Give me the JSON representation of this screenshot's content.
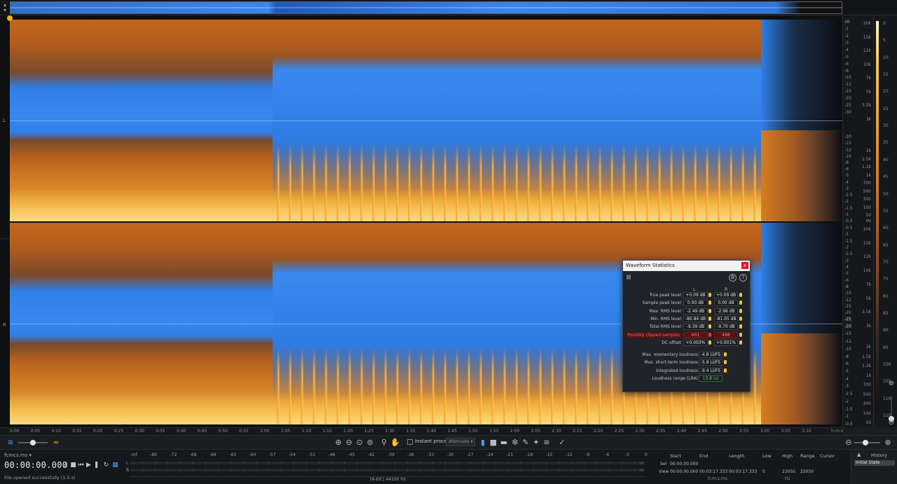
{
  "overview": {
    "collapse_icon": "collapse-icon"
  },
  "channels": {
    "left_label": "L",
    "right_label": "R"
  },
  "time_ruler": {
    "ticks": [
      "0:00",
      "0:05",
      "0:10",
      "0:15",
      "0:20",
      "0:25",
      "0:30",
      "0:35",
      "0:40",
      "0:45",
      "0:50",
      "0:55",
      "1:00",
      "1:05",
      "1:10",
      "1:15",
      "1:20",
      "1:25",
      "1:30",
      "1:35",
      "1:40",
      "1:45",
      "1:50",
      "1:55",
      "2:00",
      "2:05",
      "2:10",
      "2:15",
      "2:20",
      "2:25",
      "2:30",
      "2:35",
      "2:40",
      "2:45",
      "2:50",
      "2:55",
      "3:00",
      "3:05",
      "3:10"
    ],
    "unit": "h:m:s"
  },
  "freq_scale": {
    "db_left_top": [
      "dB",
      "-1",
      "-2",
      "-3",
      "-4",
      "-5",
      "-6",
      "-8",
      "-10",
      "-12",
      "-15",
      "-20",
      "-25",
      "-30"
    ],
    "db_left_bottom": [
      "-20",
      "-15",
      "-12",
      "-10",
      "-8",
      "-6",
      "-5",
      "-4",
      "-3",
      "-2.5",
      "-2",
      "-1.5",
      "-1",
      "-0.5"
    ],
    "hz_top": [
      "20k",
      "15k",
      "12k",
      "10k",
      "7k",
      "5k",
      "3.5k",
      "3k"
    ],
    "hz_bottom": [
      "2k",
      "1.5k",
      "1.2k",
      "1k",
      "700",
      "500",
      "300",
      "100",
      "50"
    ],
    "hz_unit": "Hz",
    "db_right_top": [
      "-0.5",
      "-1",
      "-1.5",
      "-2",
      "-2.5",
      "-3",
      "-4",
      "-5",
      "-6",
      "-8",
      "-10",
      "-12",
      "-15",
      "-20",
      "-25",
      "-30"
    ],
    "db_right_bottom": [
      "-25",
      "-20",
      "-15",
      "-12",
      "-10",
      "-8",
      "-6",
      "-5",
      "-4",
      "-3",
      "-2.5",
      "-2",
      "-1.5",
      "-1",
      "-0.5"
    ],
    "hz_r_top": [
      "20k",
      "15k",
      "12k",
      "10k",
      "7k",
      "5k",
      "3.5k",
      "3k"
    ],
    "hz_r_bottom": [
      "2k",
      "1.5k",
      "1.2k",
      "1k",
      "700",
      "500",
      "300",
      "100",
      "50"
    ]
  },
  "colorbar": {
    "labels": [
      "0",
      "10",
      "20",
      "30",
      "40",
      "50",
      "60",
      "70",
      "80",
      "90",
      "100",
      "110"
    ],
    "ticks_top": [
      "0",
      "5",
      "10",
      "15",
      "20",
      "25",
      "30",
      "35",
      "40",
      "45",
      "50",
      "55",
      "60"
    ],
    "ticks_bottom": [
      "65",
      "70",
      "75",
      "80",
      "85",
      "90",
      "95",
      "100",
      "105",
      "110",
      "115"
    ]
  },
  "toolbar": {
    "instant_process_label": "Instant process",
    "attenuate_value": "Attenuate",
    "icons": [
      "waveform-icon",
      "spectrogram-icon",
      "zoom-in-icon",
      "zoom-out-icon",
      "zoom-selection-icon",
      "zoom-full-icon",
      "magnify-icon",
      "hand-icon",
      "time-select-icon",
      "rect-select-icon",
      "freq-select-icon",
      "lasso-icon",
      "brush-icon",
      "magic-wand-icon",
      "harmonic-select-icon",
      "process-icon"
    ],
    "horizontal_zoom": 0.45,
    "spectrogram_blend": 0.5
  },
  "transport": {
    "file_name": "fcmcs.ms",
    "timecode": "00:00:00.000",
    "status": "File opened successfully (1.5 s)"
  },
  "meters": {
    "scale": [
      "-Inf.",
      "-80",
      "-72",
      "-69",
      "-66",
      "-63",
      "-60",
      "-57",
      "-54",
      "-51",
      "-48",
      "-45",
      "-42",
      "-39",
      "-36",
      "-33",
      "-30",
      "-27",
      "-24",
      "-21",
      "-18",
      "-15",
      "-12",
      "-9",
      "-6",
      "-3",
      "0"
    ],
    "left_label": "L",
    "right_label": "R",
    "format": "16-bit | 44100 Hz"
  },
  "selection": {
    "headers": {
      "start": "Start",
      "end": "End",
      "length": "Length",
      "low": "Low",
      "high": "High",
      "range": "Range",
      "cursor": "Cursor"
    },
    "sel_label": "Sel",
    "view_label": "View",
    "sel_start": "00:00:00.000",
    "view_start": "00:00:00.000",
    "view_end": "00:03:17.333",
    "view_length": "00:03:17.333",
    "time_unit": "h:m:s.ms",
    "view_low": "0",
    "view_high": "22050",
    "view_range": "22050",
    "freq_unit": "Hz"
  },
  "history": {
    "title": "History",
    "item": "Initial State"
  },
  "waveform_statistics": {
    "title": "Waveform Statistics",
    "close": "x",
    "col_left": "L",
    "col_right": "R",
    "rows": [
      {
        "name": "True peak level",
        "l": "+0.09 dB",
        "r": "+0.09 dB"
      },
      {
        "name": "Sample peak level",
        "l": "0.00 dB",
        "r": "0.00 dB"
      },
      {
        "name": "Max. RMS level",
        "l": "-2.49 dB",
        "r": "-2.96 dB"
      },
      {
        "name": "Min. RMS level",
        "l": "-80.84 dB",
        "r": "-81.05 dB"
      },
      {
        "name": "Total RMS level",
        "l": "-9.39 dB",
        "r": "-9.70 dB"
      },
      {
        "name": "Possibly clipped samples",
        "l": "601",
        "r": "468"
      },
      {
        "name": "DC offset",
        "l": "+0.003%",
        "r": "+0.001%"
      }
    ],
    "loudness": [
      {
        "name": "Max. momentary loudness",
        "value": "-4.8 LUFS"
      },
      {
        "name": "Max. short-term loudness",
        "value": "-5.8 LUFS"
      },
      {
        "name": "Integrated loudness",
        "value": "-9.4 LUFS"
      },
      {
        "name": "Loudness range (LRA)",
        "value": "13.8 LU"
      }
    ]
  },
  "colors": {
    "accent": "#2f7fe6",
    "spectral_hot": "#f1b24a",
    "clip_warning": "#ff3b2b",
    "lra_green": "#6cd96c"
  }
}
